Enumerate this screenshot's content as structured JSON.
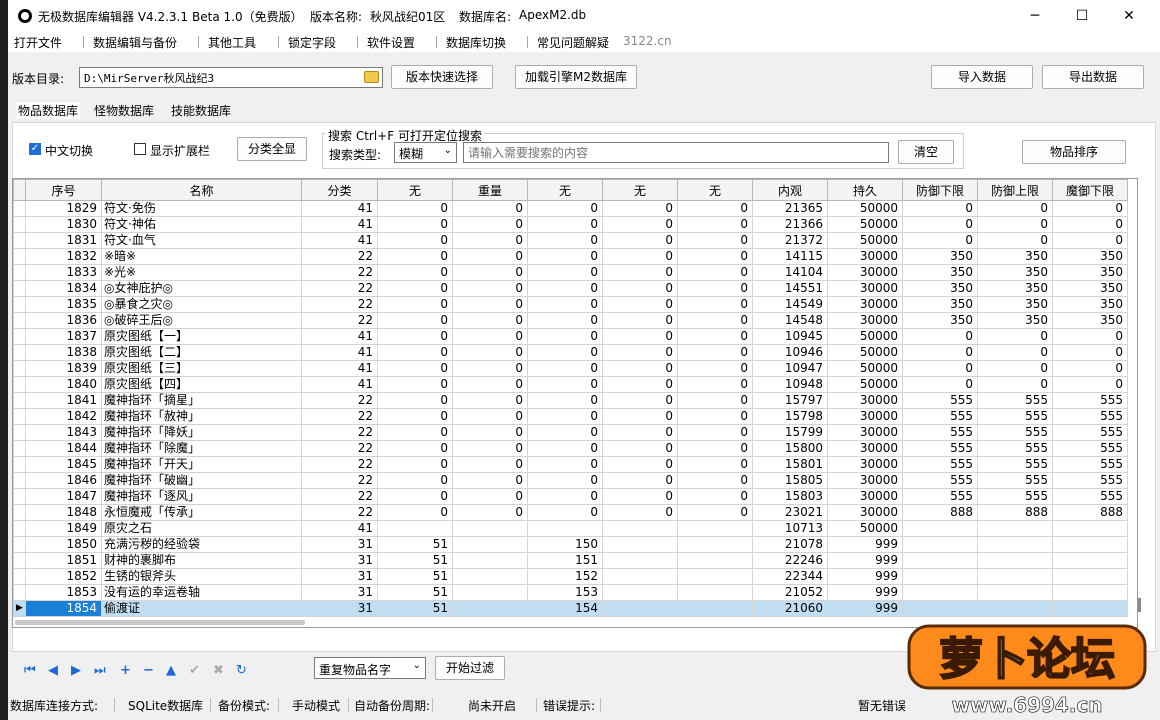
{
  "window": {
    "title": "无极数据库编辑器 V4.2.3.1",
    "beta": "Beta 1.0（免费版）",
    "version_label": "版本名称:",
    "version_value": "秋风战纪01区",
    "db_label": "数据库名:",
    "db_value": "ApexM2.db",
    "minimize": "─",
    "maximize": "☐",
    "close": "✕"
  },
  "menu": [
    "打开文件",
    "数据编辑与备份",
    "其他工具",
    "锁定字段",
    "软件设置",
    "数据库切换",
    "常见问题解疑",
    "3122.cn"
  ],
  "toolbar": {
    "dir_label": "版本目录:",
    "dir_value": "D:\\MirServer秋风战纪3",
    "quick_select": "版本快速选择",
    "load_engine": "加载引擎M2数据库",
    "import": "导入数据",
    "export": "导出数据"
  },
  "tabs": [
    "物品数据库",
    "怪物数据库",
    "技能数据库"
  ],
  "filters": {
    "cn_switch": "中文切换",
    "show_ext": "显示扩展栏",
    "category_all": "分类全显",
    "search_title": "搜索  Ctrl+F 可打开定位搜索",
    "search_type_label": "搜索类型:",
    "search_type_value": "模糊",
    "search_placeholder": "请输入需要搜索的内容",
    "clear": "清空",
    "sort": "物品排序"
  },
  "table": {
    "headers": [
      "序号",
      "名称",
      "分类",
      "无",
      "重量",
      "无",
      "无",
      "无",
      "内观",
      "持久",
      "防御下限",
      "防御上限",
      "魔御下限"
    ],
    "rows": [
      [
        "1829",
        "符文·免伤",
        "41",
        "0",
        "0",
        "0",
        "0",
        "0",
        "21365",
        "50000",
        "0",
        "0",
        "0"
      ],
      [
        "1830",
        "符文·神佑",
        "41",
        "0",
        "0",
        "0",
        "0",
        "0",
        "21366",
        "50000",
        "0",
        "0",
        "0"
      ],
      [
        "1831",
        "符文·血气",
        "41",
        "0",
        "0",
        "0",
        "0",
        "0",
        "21372",
        "50000",
        "0",
        "0",
        "0"
      ],
      [
        "1832",
        "※暗※",
        "22",
        "0",
        "0",
        "0",
        "0",
        "0",
        "14115",
        "30000",
        "350",
        "350",
        "350"
      ],
      [
        "1833",
        "※光※",
        "22",
        "0",
        "0",
        "0",
        "0",
        "0",
        "14104",
        "30000",
        "350",
        "350",
        "350"
      ],
      [
        "1834",
        "◎女神庇护◎",
        "22",
        "0",
        "0",
        "0",
        "0",
        "0",
        "14551",
        "30000",
        "350",
        "350",
        "350"
      ],
      [
        "1835",
        "◎暴食之灾◎",
        "22",
        "0",
        "0",
        "0",
        "0",
        "0",
        "14549",
        "30000",
        "350",
        "350",
        "350"
      ],
      [
        "1836",
        "◎破碎王后◎",
        "22",
        "0",
        "0",
        "0",
        "0",
        "0",
        "14548",
        "30000",
        "350",
        "350",
        "350"
      ],
      [
        "1837",
        "原灾图纸【一】",
        "41",
        "0",
        "0",
        "0",
        "0",
        "0",
        "10945",
        "50000",
        "0",
        "0",
        "0"
      ],
      [
        "1838",
        "原灾图纸【二】",
        "41",
        "0",
        "0",
        "0",
        "0",
        "0",
        "10946",
        "50000",
        "0",
        "0",
        "0"
      ],
      [
        "1839",
        "原灾图纸【三】",
        "41",
        "0",
        "0",
        "0",
        "0",
        "0",
        "10947",
        "50000",
        "0",
        "0",
        "0"
      ],
      [
        "1840",
        "原灾图纸【四】",
        "41",
        "0",
        "0",
        "0",
        "0",
        "0",
        "10948",
        "50000",
        "0",
        "0",
        "0"
      ],
      [
        "1841",
        "魔神指环「摘星」",
        "22",
        "0",
        "0",
        "0",
        "0",
        "0",
        "15797",
        "30000",
        "555",
        "555",
        "555"
      ],
      [
        "1842",
        "魔神指环「赦神」",
        "22",
        "0",
        "0",
        "0",
        "0",
        "0",
        "15798",
        "30000",
        "555",
        "555",
        "555"
      ],
      [
        "1843",
        "魔神指环「降妖」",
        "22",
        "0",
        "0",
        "0",
        "0",
        "0",
        "15799",
        "30000",
        "555",
        "555",
        "555"
      ],
      [
        "1844",
        "魔神指环「除魔」",
        "22",
        "0",
        "0",
        "0",
        "0",
        "0",
        "15800",
        "30000",
        "555",
        "555",
        "555"
      ],
      [
        "1845",
        "魔神指环「开天」",
        "22",
        "0",
        "0",
        "0",
        "0",
        "0",
        "15801",
        "30000",
        "555",
        "555",
        "555"
      ],
      [
        "1846",
        "魔神指环「破幽」",
        "22",
        "0",
        "0",
        "0",
        "0",
        "0",
        "15805",
        "30000",
        "555",
        "555",
        "555"
      ],
      [
        "1847",
        "魔神指环「逐风」",
        "22",
        "0",
        "0",
        "0",
        "0",
        "0",
        "15803",
        "30000",
        "555",
        "555",
        "555"
      ],
      [
        "1848",
        "永恒魔戒「传承」",
        "22",
        "0",
        "0",
        "0",
        "0",
        "0",
        "23021",
        "30000",
        "888",
        "888",
        "888"
      ],
      [
        "1849",
        "原灾之石",
        "41",
        "",
        "",
        "",
        "",
        "",
        "10713",
        "50000",
        "",
        "",
        ""
      ],
      [
        "1850",
        "充满污秽的经验袋",
        "31",
        "51",
        "",
        "150",
        "",
        "",
        "21078",
        "999",
        "",
        "",
        ""
      ],
      [
        "1851",
        "财神的裹脚布",
        "31",
        "51",
        "",
        "151",
        "",
        "",
        "22246",
        "999",
        "",
        "",
        ""
      ],
      [
        "1852",
        "生锈的银斧头",
        "31",
        "51",
        "",
        "152",
        "",
        "",
        "22344",
        "999",
        "",
        "",
        ""
      ],
      [
        "1853",
        "没有运的幸运卷轴",
        "31",
        "51",
        "",
        "153",
        "",
        "",
        "21052",
        "999",
        "",
        "",
        ""
      ],
      [
        "1854",
        "偷渡证",
        "31",
        "51",
        "",
        "154",
        "",
        "",
        "21060",
        "999",
        "",
        "",
        ""
      ]
    ],
    "selected_index": 25
  },
  "nav": {
    "buttons": [
      "⏮",
      "◀",
      "▶",
      "⏭",
      "+",
      "−",
      "▲",
      "✔",
      "✖",
      "↻"
    ],
    "filter_select": "重复物品名字",
    "start_filter": "开始过滤"
  },
  "status": {
    "conn_label": "数据库连接方式:",
    "conn_value": "SQLite数据库",
    "backup_label": "备份模式:",
    "backup_value": "手动模式",
    "auto_label": "自动备份周期:",
    "auto_value": "尚未开启",
    "err_label": "错误提示:",
    "err_value": "暂无错误"
  },
  "watermark": {
    "text": "萝卜论坛",
    "url": "www.6994.cn"
  }
}
